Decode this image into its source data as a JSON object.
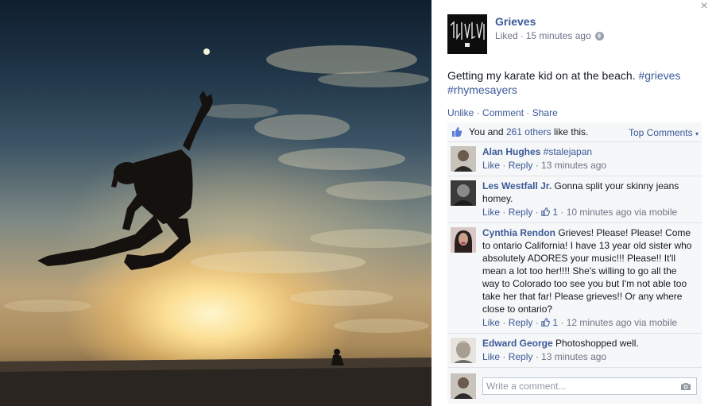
{
  "post": {
    "author": "Grieves",
    "avatar_logo_text": "GRIEVES",
    "status_prefix": "Liked",
    "separator": "·",
    "timestamp": "15 minutes ago",
    "message": "Getting my karate kid on at the beach.",
    "hashtags": [
      "#grieves",
      "#rhymesayers"
    ]
  },
  "actions": {
    "unlike": "Unlike",
    "comment": "Comment",
    "share": "Share",
    "sep": "·"
  },
  "likes": {
    "prefix": "You and",
    "others": "261 others",
    "suffix": "like this.",
    "top_comments": "Top Comments"
  },
  "comments": [
    {
      "name": "Alan Hughes",
      "text": "",
      "tag": "#stalejapan",
      "like": "Like",
      "reply": "Reply",
      "like_count": "",
      "time": "13 minutes ago",
      "via": ""
    },
    {
      "name": "Les Westfall Jr.",
      "text": "Gonna split your skinny jeans homey.",
      "tag": "",
      "like": "Like",
      "reply": "Reply",
      "like_count": "1",
      "time": "10 minutes ago",
      "via": "via mobile"
    },
    {
      "name": "Cynthia Rendon",
      "text": "Grieves! Please! Please! Come to ontario California! I have 13 year old sister who absolutely ADORES your music!!! Please!! It'll mean a lot too her!!!! She's willing to go all the way to Colorado too see you but I'm not able too take her that far! Please grieves!! Or any where close to ontario?",
      "tag": "",
      "like": "Like",
      "reply": "Reply",
      "like_count": "1",
      "time": "12 minutes ago",
      "via": "via mobile"
    },
    {
      "name": "Edward George",
      "text": "Photoshopped well.",
      "tag": "",
      "like": "Like",
      "reply": "Reply",
      "like_count": "",
      "time": "13 minutes ago",
      "via": ""
    }
  ],
  "composer": {
    "placeholder": "Write a comment..."
  },
  "close": "×",
  "colors": {
    "link": "#3b5998",
    "meta": "#6d7487",
    "ufi_bg": "#f6f7f8"
  },
  "icons": [
    "close-icon",
    "globe-icon",
    "like-thumb-icon",
    "caret-down-icon",
    "camera-icon"
  ]
}
